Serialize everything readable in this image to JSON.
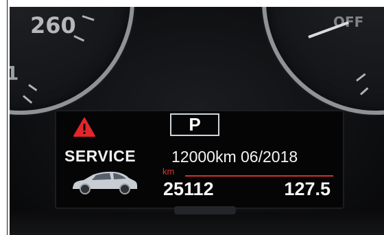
{
  "instrument_cluster": {
    "speedometer": {
      "label_260": "260",
      "label_partial": "1"
    },
    "right_gauge": {
      "label": "OFF"
    },
    "display": {
      "gear": "P",
      "warning_icon": "warning-triangle-icon",
      "warning_color": "#e3262b",
      "service_label": "SERVICE",
      "car_icon": "car-icon",
      "service_due": "12000km 06/2018",
      "unit": "km",
      "accent_color": "#d43127",
      "odometer": "25112",
      "trip": "127.5"
    }
  }
}
